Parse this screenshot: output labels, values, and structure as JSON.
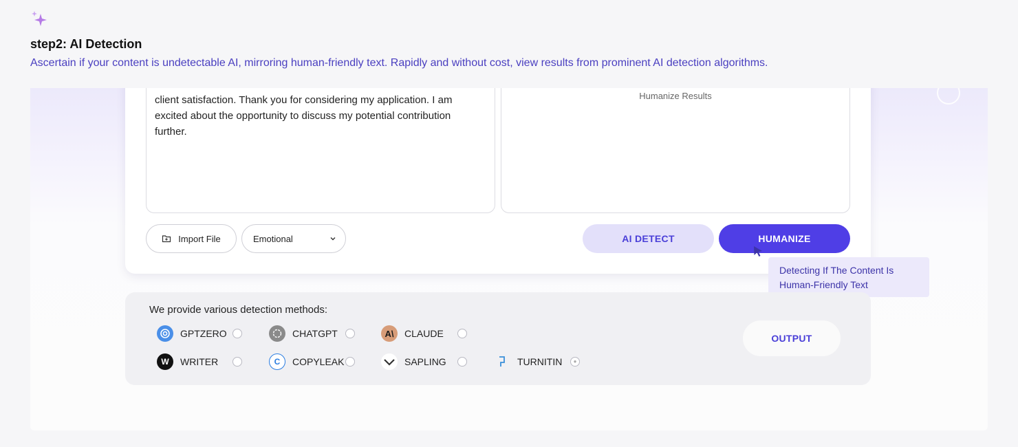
{
  "header": {
    "icon": "sparkle-icon",
    "title": "step2: AI Detection",
    "description": "Ascertain if your content is undetectable AI, mirroring human-friendly text. Rapidly and without cost, view results from prominent AI detection algorithms."
  },
  "editor": {
    "input_text_lines": [
      "client satisfaction. Thank you for considering my application. I am",
      "excited about the opportunity to discuss my potential contribution",
      "further."
    ],
    "results_label": "Humanize Results"
  },
  "toolbar": {
    "import_label": "Import File",
    "tone_value": "Emotional",
    "detect_label": "AI DETECT",
    "humanize_label": "HUMANIZE"
  },
  "tooltip": {
    "text_line1": "Detecting If The Content Is",
    "text_line2": "Human-Friendly Text"
  },
  "methods": {
    "title": "We provide various detection methods:",
    "items": [
      {
        "name": "GPTZERO",
        "icon": "gptzero-icon"
      },
      {
        "name": "CHATGPT",
        "icon": "chatgpt-icon"
      },
      {
        "name": "CLAUDE",
        "icon": "claude-icon"
      },
      {
        "name": "WRITER",
        "icon": "writer-icon"
      },
      {
        "name": "COPYLEAK",
        "icon": "copyleak-icon"
      },
      {
        "name": "SAPLING",
        "icon": "sapling-icon"
      },
      {
        "name": "TURNITIN",
        "icon": "turnitin-icon",
        "locked": true
      }
    ],
    "output_label": "OUTPUT"
  },
  "colors": {
    "accent": "#4f3ee6",
    "accent_light": "#e3e0fa",
    "description_text": "#4a3fc0"
  }
}
